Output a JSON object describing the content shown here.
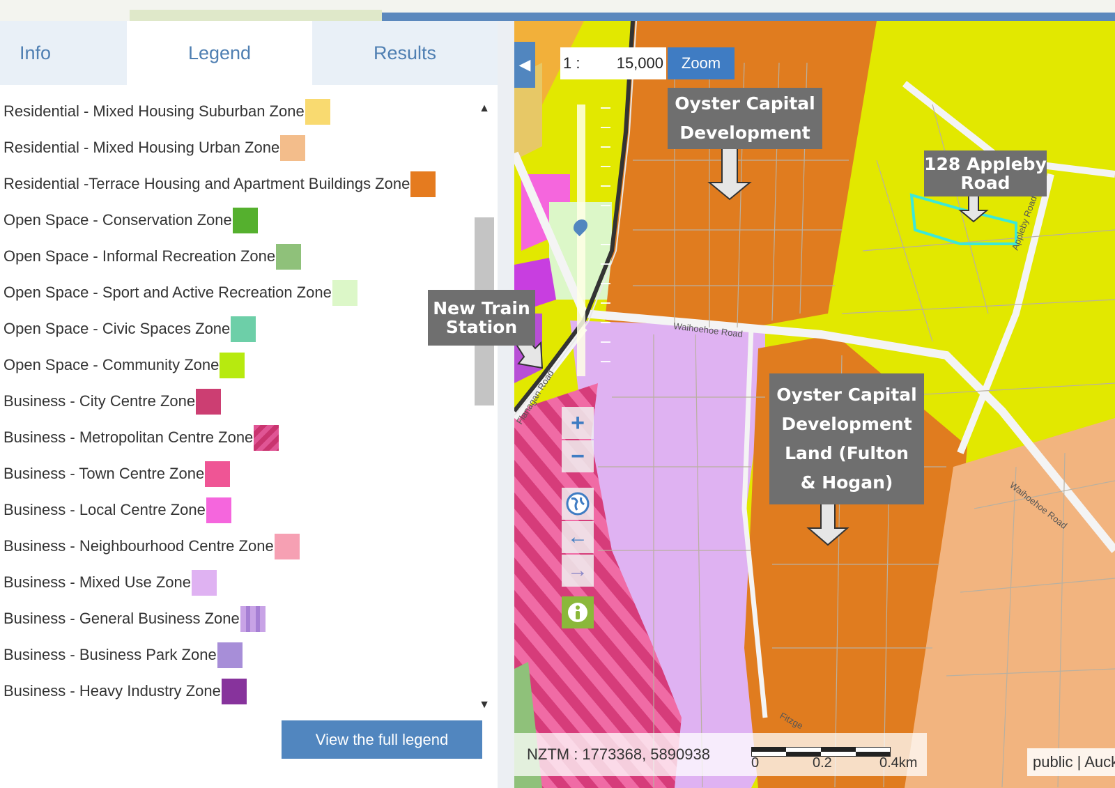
{
  "tabs": [
    {
      "label": "Info"
    },
    {
      "label": "Legend"
    },
    {
      "label": "Results"
    }
  ],
  "legend": {
    "items": [
      {
        "label": "Residential - Mixed Housing Suburban Zone",
        "color": "#f9da70"
      },
      {
        "label": "Residential - Mixed Housing Urban Zone",
        "color": "#f3bd8b"
      },
      {
        "label": "Residential -Terrace Housing and Apartment Buildings Zone",
        "color": "#e57b1f"
      },
      {
        "label": "Open Space - Conservation Zone",
        "color": "#55b02e"
      },
      {
        "label": "Open Space - Informal Recreation Zone",
        "color": "#8fc17a"
      },
      {
        "label": "Open Space - Sport and Active Recreation Zone",
        "color": "#dcf7c8"
      },
      {
        "label": "Open Space - Civic Spaces Zone",
        "color": "#6dcfa8"
      },
      {
        "label": "Open Space - Community Zone",
        "color": "#b7ea0f"
      },
      {
        "label": "Business - City Centre Zone",
        "color": "#cc3e72"
      },
      {
        "label": "Business - Metropolitan Centre Zone",
        "color": "#e05595",
        "pattern": "hatched"
      },
      {
        "label": "Business - Town Centre Zone",
        "color": "#ef5595"
      },
      {
        "label": "Business - Local Centre Zone",
        "color": "#f566dd"
      },
      {
        "label": "Business - Neighbourhood Centre Zone",
        "color": "#f6a0b3"
      },
      {
        "label": "Business - Mixed Use Zone",
        "color": "#dfb2f2"
      },
      {
        "label": "Business - General Business Zone",
        "color": "#c8a3e6",
        "pattern": "striped"
      },
      {
        "label": "Business - Business Park Zone",
        "color": "#a78ed8"
      },
      {
        "label": "Business - Heavy Industry Zone",
        "color": "#87339c"
      }
    ],
    "full_legend_label": "View the full legend"
  },
  "map": {
    "scale_prefix": "1 :",
    "scale_value": "15,000",
    "zoom_label": "Zoom",
    "annotations": {
      "oyster_top": "Oyster Capital Development",
      "appleby": "128 Appleby Road",
      "train": "New Train Station",
      "fulton": "Oyster Capital Development Land (Fulton & Hogan)"
    },
    "roads": {
      "waihoehoe_1": "Waihoehoe Road",
      "waihoehoe_2": "Waihoehoe Road",
      "flanagan": "Flanagan Road",
      "appleby_road": "Appleby Road",
      "fitzgerald": "Fitzge"
    },
    "coords": "NZTM : 1773368, 5890938",
    "scale_labels": [
      "0",
      "0.2",
      "0.4km"
    ],
    "credit": "public | Auckland"
  }
}
